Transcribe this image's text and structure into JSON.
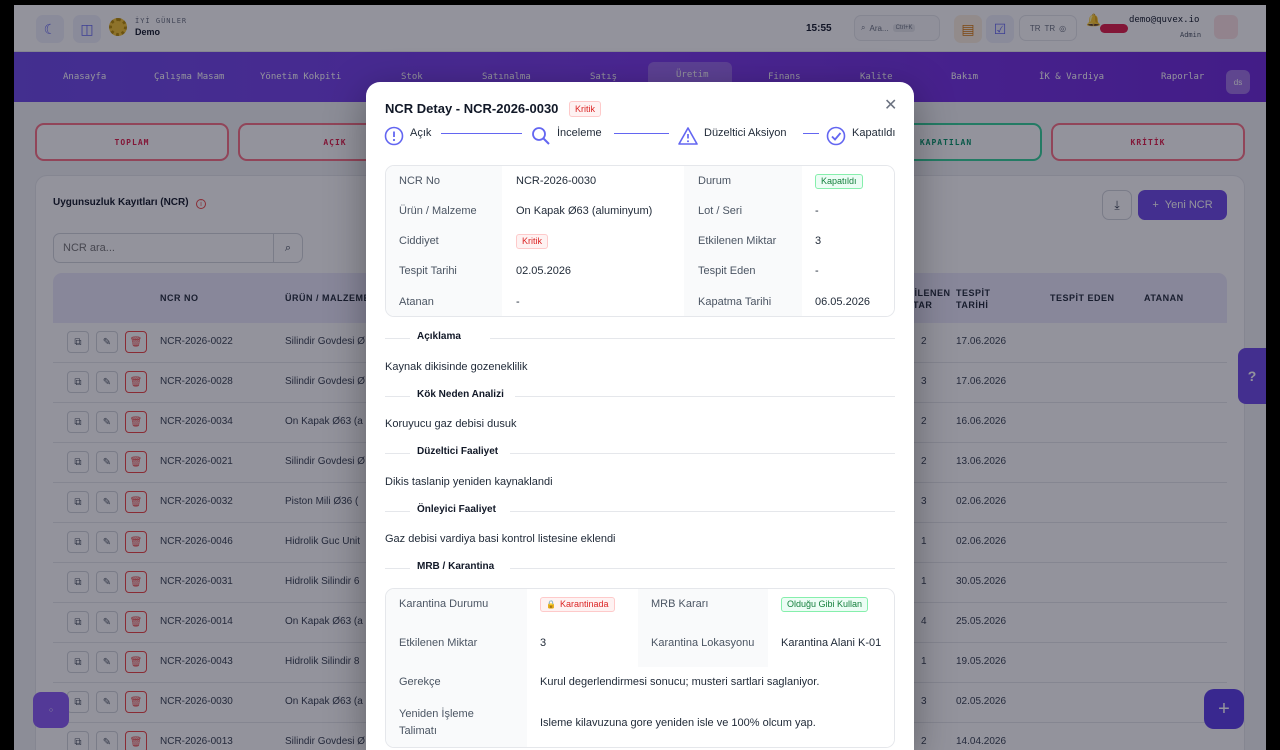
{
  "header": {
    "greeting": "İYİ GÜNLER",
    "company": "Demo",
    "clock": "15:55",
    "search_placeholder": "Ara...",
    "search_shortcut": "Ctrl+K",
    "language": "TR",
    "user_email": "demo@quvex.io",
    "user_role": "Admin"
  },
  "nav": {
    "items": [
      "Anasayfa",
      "Çalışma Masam",
      "Yönetim Kokpiti",
      "Stok",
      "Satınalma",
      "Satış",
      "Üretim",
      "Finans",
      "Kalite",
      "Bakım",
      "İK & Vardiya",
      "Raporlar"
    ],
    "active": "Üretim",
    "user_initials": "ds"
  },
  "stats": {
    "total": "TOPLAM",
    "open": "AÇIK",
    "closed": "KAPATILAN",
    "critical": "KRİTİK"
  },
  "list": {
    "title": "Uygunsuzluk Kayıtları (NCR)",
    "search_placeholder": "NCR ara...",
    "new_button": "Yeni NCR",
    "columns": [
      "NCR NO",
      "ÜRÜN / MALZEME",
      "ETKİLENEN MİKTAR",
      "TESPİT TARİHİ",
      "TESPİT EDEN",
      "ATANAN"
    ],
    "rows": [
      {
        "no": "NCR-2026-0022",
        "product": "Silindir Govdesi Ø",
        "qty": "2",
        "date": "17.06.2026"
      },
      {
        "no": "NCR-2026-0028",
        "product": "Silindir Govdesi Ø",
        "qty": "3",
        "date": "17.06.2026"
      },
      {
        "no": "NCR-2026-0034",
        "product": "On Kapak Ø63 (a",
        "qty": "2",
        "date": "16.06.2026"
      },
      {
        "no": "NCR-2026-0021",
        "product": "Silindir Govdesi Ø",
        "qty": "2",
        "date": "13.06.2026"
      },
      {
        "no": "NCR-2026-0032",
        "product": "Piston Mili Ø36 (",
        "qty": "3",
        "date": "02.06.2026"
      },
      {
        "no": "NCR-2026-0046",
        "product": "Hidrolik Guc Unit",
        "qty": "1",
        "date": "02.06.2026"
      },
      {
        "no": "NCR-2026-0031",
        "product": "Hidrolik Silindir 6",
        "qty": "1",
        "date": "30.05.2026"
      },
      {
        "no": "NCR-2026-0014",
        "product": "On Kapak Ø63 (a",
        "qty": "4",
        "date": "25.05.2026"
      },
      {
        "no": "NCR-2026-0043",
        "product": "Hidrolik Silindir 8",
        "qty": "1",
        "date": "19.05.2026"
      },
      {
        "no": "NCR-2026-0030",
        "product": "On Kapak Ø63 (a",
        "qty": "3",
        "date": "02.05.2026"
      },
      {
        "no": "NCR-2026-0013",
        "product": "Silindir Govdesi Ø",
        "qty": "2",
        "date": "14.04.2026"
      }
    ]
  },
  "modal": {
    "title": "NCR Detay - NCR-2026-0030",
    "severity": "Kritik",
    "steps": [
      "Açık",
      "İnceleme",
      "Düzeltici Aksiyon",
      "Kapatıldı"
    ],
    "details": {
      "ncr_no_label": "NCR No",
      "ncr_no": "NCR-2026-0030",
      "status_label": "Durum",
      "status": "Kapatıldı",
      "product_label": "Ürün / Malzeme",
      "product": "On Kapak Ø63 (aluminyum)",
      "lot_label": "Lot / Seri",
      "lot": "-",
      "severity_label": "Ciddiyet",
      "severity": "Kritik",
      "affected_label": "Etkilenen Miktar",
      "affected": "3",
      "detect_date_label": "Tespit Tarihi",
      "detect_date": "02.05.2026",
      "detected_by_label": "Tespit Eden",
      "detected_by": "-",
      "assigned_label": "Atanan",
      "assigned": "-",
      "close_date_label": "Kapatma Tarihi",
      "close_date": "06.05.2026"
    },
    "sections": {
      "description_title": "Açıklama",
      "description": "Kaynak dikisinde gozeneklilik",
      "root_cause_title": "Kök Neden Analizi",
      "root_cause": "Koruyucu gaz debisi dusuk",
      "corrective_title": "Düzeltici Faaliyet",
      "corrective": "Dikis taslanip yeniden kaynaklandi",
      "preventive_title": "Önleyici Faaliyet",
      "preventive": "Gaz debisi vardiya basi kontrol listesine eklendi",
      "mrb_title": "MRB / Karantina"
    },
    "mrb": {
      "quarantine_status_label": "Karantina Durumu",
      "quarantine_status": "Karantinada",
      "mrb_decision_label": "MRB Kararı",
      "mrb_decision": "Olduğu Gibi Kullan",
      "affected_label": "Etkilenen Miktar",
      "affected": "3",
      "location_label": "Karantina Lokasyonu",
      "location": "Karantina Alani K-01",
      "justification_label": "Gerekçe",
      "justification": "Kurul degerlendirmesi sonucu; musteri sartlari saglaniyor.",
      "rework_label": "Yeniden İşleme Talimatı",
      "rework": "Isleme kilavuzuna gore yeniden isle ve 100% olcum yap."
    }
  }
}
